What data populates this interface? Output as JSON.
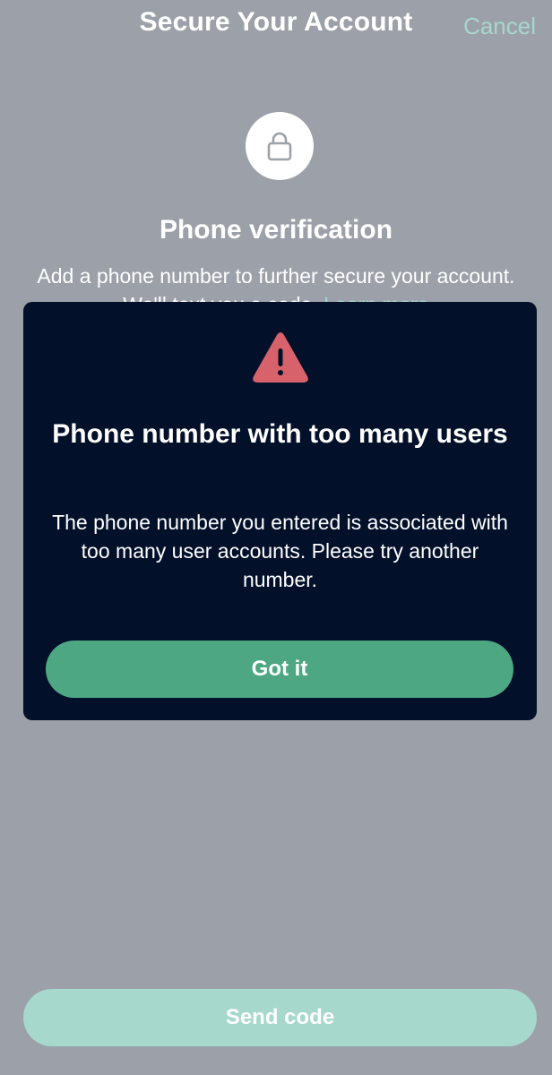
{
  "header": {
    "title": "Secure Your Account",
    "cancel_label": "Cancel"
  },
  "verification": {
    "icon": "lock-icon",
    "title": "Phone verification",
    "description": "Add a phone number to further secure your account. We'll text you a code.",
    "learn_more": "Learn more"
  },
  "dialog": {
    "icon": "warning-icon",
    "title": "Phone number with too many users",
    "body": "The phone number you entered is associated with too many user accounts. Please try another number.",
    "confirm_label": "Got it"
  },
  "footer": {
    "send_code_label": "Send code"
  },
  "colors": {
    "overlay_background": "#9ca0a8",
    "accent": "#a7d8cc",
    "dialog_background": "#02102a",
    "confirm_button": "#4ea783",
    "warning": "#d8626b"
  }
}
